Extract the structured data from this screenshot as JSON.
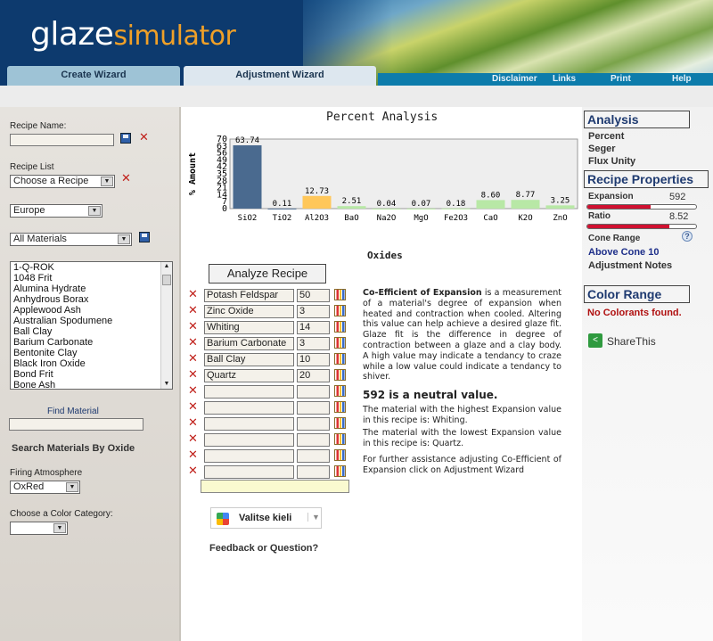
{
  "header": {
    "logo_part1": "glaze",
    "logo_part2": "simulator",
    "tabs": [
      "Create Wizard",
      "Adjustment Wizard"
    ],
    "nav": [
      "Disclaimer",
      "Links",
      "Print",
      "Help"
    ]
  },
  "left": {
    "recipe_name_label": "Recipe Name:",
    "recipe_name_value": "",
    "recipe_list_label": "Recipe List",
    "recipe_list_selected": "Choose a Recipe",
    "region_selected": "Europe",
    "materials_filter_selected": "All Materials",
    "materials": [
      "1-Q-ROK",
      "1048 Frit",
      "Alumina Hydrate",
      "Anhydrous Borax",
      "Applewood Ash",
      "Australian Spodumene",
      "Ball Clay",
      "Barium Carbonate",
      "Bentonite Clay",
      "Black Iron Oxide",
      "Bond Frit",
      "Bone Ash"
    ],
    "find_material_label": "Find Material",
    "search_oxide_label": "Search Materials By Oxide",
    "firing_atmosphere_label": "Firing Atmosphere",
    "firing_atmosphere_selected": "OxRed",
    "color_category_label": "Choose a Color Category:",
    "color_category_selected": ""
  },
  "chart_data": {
    "type": "bar",
    "title": "Percent Analysis",
    "xlabel": "Oxides",
    "ylabel": "% Amount",
    "ylim": [
      0,
      70
    ],
    "yticks": [
      0,
      7,
      14,
      21,
      28,
      35,
      42,
      49,
      56,
      63,
      70
    ],
    "categories": [
      "SiO2",
      "TiO2",
      "Al2O3",
      "BaO",
      "Na2O",
      "MgO",
      "Fe2O3",
      "CaO",
      "K2O",
      "ZnO"
    ],
    "values": [
      63.74,
      0.11,
      12.73,
      2.51,
      0.04,
      0.07,
      0.18,
      8.6,
      8.77,
      3.25
    ],
    "value_labels": [
      "63.74",
      "0.11",
      "12.73",
      "2.51",
      "0.04",
      "0.07",
      "0.18",
      "8.60",
      "8.77",
      "3.25"
    ],
    "colors": [
      "#4a6a8f",
      "#4a6a8f",
      "#ffc75a",
      "#b8e8a6",
      "#b8e8a6",
      "#b8e8a6",
      "#b8e8a6",
      "#b8e8a6",
      "#b8e8a6",
      "#b8e8a6"
    ],
    "background": "#eeeeee",
    "grid": false
  },
  "analyze_button_label": "Analyze Recipe",
  "recipe_rows": [
    {
      "material": "Potash Feldspar",
      "amount": "50"
    },
    {
      "material": "Zinc Oxide",
      "amount": "3"
    },
    {
      "material": "Whiting",
      "amount": "14"
    },
    {
      "material": "Barium Carbonate",
      "amount": "3"
    },
    {
      "material": "Ball Clay",
      "amount": "10"
    },
    {
      "material": "Quartz",
      "amount": "20"
    },
    {
      "material": "",
      "amount": ""
    },
    {
      "material": "",
      "amount": ""
    },
    {
      "material": "",
      "amount": ""
    },
    {
      "material": "",
      "amount": ""
    },
    {
      "material": "",
      "amount": ""
    },
    {
      "material": "",
      "amount": ""
    }
  ],
  "translate_label": "Valitse kieli",
  "feedback_label": "Feedback or Question?",
  "info": {
    "coe_term": "Co-Efficient of Expansion",
    "coe_text": " is a measurement of a material's degree of expansion when heated and contraction when cooled. Altering this value can help achieve a desired glaze fit. Glaze fit is the difference in degree of contraction between a glaze and a clay body. A high value may indicate a tendancy to craze while a low value could indicate a tendancy to shiver.",
    "neutral": "592 is a neutral value.",
    "highest": "The material with the highest Expansion value in this recipe is: Whiting.",
    "lowest": "The material with the lowest Expansion value in this recipe is: Quartz.",
    "further": "For further assistance adjusting Co-Efficient of Expansion click on Adjustment Wizard"
  },
  "right": {
    "analysis_title": "Analysis",
    "analysis_links": [
      "Percent",
      "Seger",
      "Flux Unity"
    ],
    "recipe_props_title": "Recipe Properties",
    "expansion_label": "Expansion",
    "expansion_value": "592",
    "expansion_fill": 0.58,
    "ratio_label": "Ratio",
    "ratio_value": "8.52",
    "ratio_fill": 0.75,
    "cone_range_label": "Cone Range",
    "cone_value": "Above Cone 10",
    "adjustment_notes": "Adjustment Notes",
    "color_range_title": "Color Range",
    "no_colorants": "No Colorants found.",
    "share_label": "ShareThis"
  }
}
